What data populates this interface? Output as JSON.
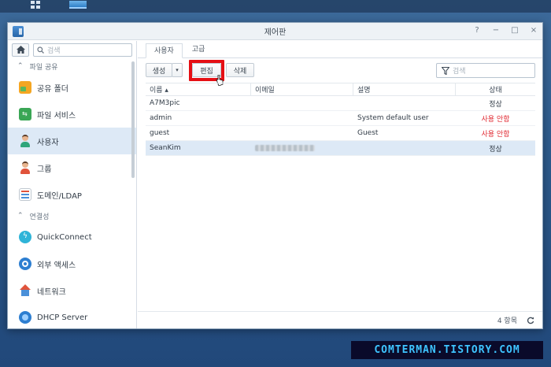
{
  "window": {
    "title": "제어판",
    "controls": [
      "?",
      "−",
      "□",
      "×"
    ]
  },
  "sidebar": {
    "search_placeholder": "검색",
    "sections": [
      {
        "label": "파일 공유",
        "items": [
          {
            "label": "공유 폴더",
            "icon": "shared-folder-icon"
          },
          {
            "label": "파일 서비스",
            "icon": "file-services-icon"
          },
          {
            "label": "사용자",
            "icon": "user-icon",
            "active": true
          },
          {
            "label": "그룹",
            "icon": "group-icon"
          },
          {
            "label": "도메인/LDAP",
            "icon": "domain-ldap-icon"
          }
        ]
      },
      {
        "label": "연결성",
        "items": [
          {
            "label": "QuickConnect",
            "icon": "quickconnect-icon"
          },
          {
            "label": "외부 액세스",
            "icon": "external-access-icon"
          },
          {
            "label": "네트워크",
            "icon": "network-icon"
          },
          {
            "label": "DHCP Server",
            "icon": "dhcp-server-icon"
          }
        ]
      }
    ]
  },
  "tabs": [
    "사용자",
    "고급"
  ],
  "toolbar": {
    "create_label": "생성",
    "edit_label": "편집",
    "delete_label": "삭제",
    "filter_placeholder": "검색"
  },
  "table": {
    "columns": [
      "이름 ▴",
      "이메일",
      "설명",
      "상태"
    ],
    "rows": [
      {
        "name": "A7M3pic",
        "email": "",
        "desc": "",
        "status": "정상",
        "status_kind": "normal"
      },
      {
        "name": "admin",
        "email": "",
        "desc": "System default user",
        "status": "사용 안함",
        "status_kind": "disabled"
      },
      {
        "name": "guest",
        "email": "",
        "desc": "Guest",
        "status": "사용 안함",
        "status_kind": "disabled"
      },
      {
        "name": "SeanKim",
        "email": "blurred",
        "desc": "",
        "status": "정상",
        "status_kind": "normal",
        "selected": true
      }
    ]
  },
  "footer": {
    "count": "4 항목"
  },
  "watermark": "COMTERMAN.TISTORY.COM",
  "colors": {
    "accent": "#e50f14",
    "disabled_status": "#e0262f",
    "selected_row": "#dde9f6"
  }
}
